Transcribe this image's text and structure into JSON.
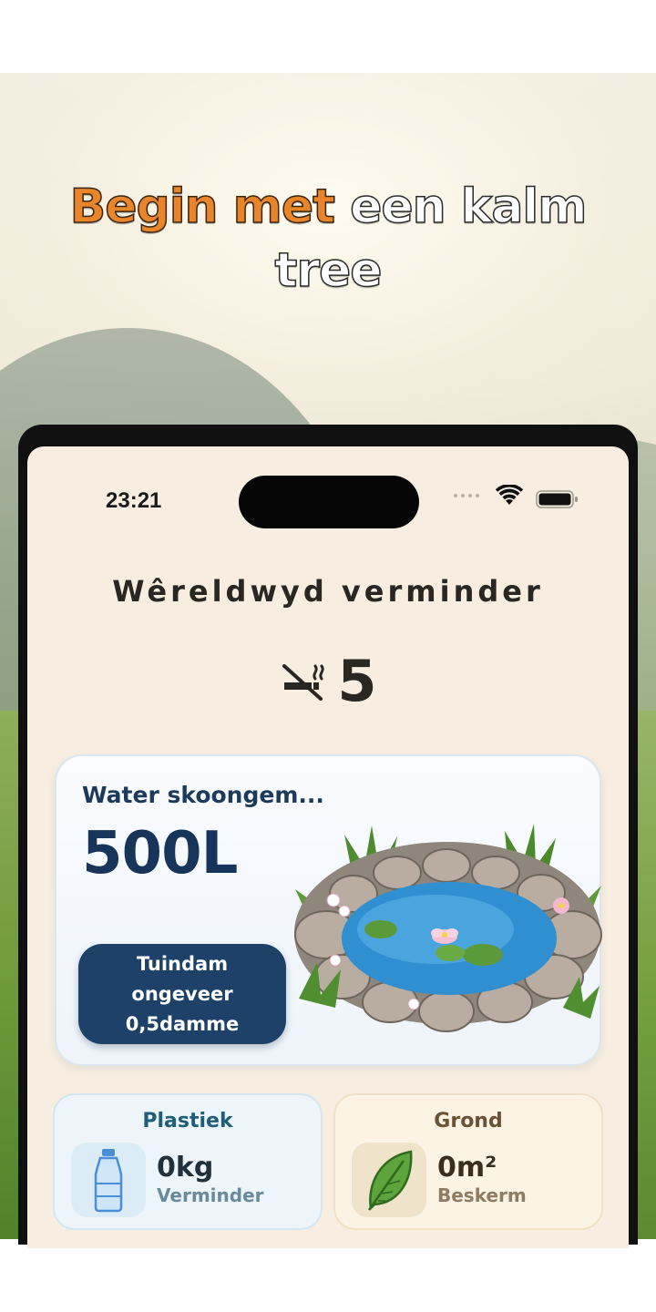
{
  "headline": {
    "accent": "Begin met",
    "rest": "een kalm",
    "line2": "tree"
  },
  "status_bar": {
    "time": "23:21",
    "icons": [
      "signal-dots-icon",
      "wifi-icon",
      "battery-icon"
    ]
  },
  "reduction": {
    "title": "Wêreldwyd verminder",
    "icon": "no-smoking-icon",
    "count": "5"
  },
  "water_card": {
    "label": "Water skoongem...",
    "amount": "500L",
    "equivalent": "Tuindam\nongeveer\n0,5damme",
    "illustration": "pond-illustration"
  },
  "plastic_card": {
    "title": "Plastiek",
    "icon": "water-bottle-icon",
    "value": "0kg",
    "subtitle": "Verminder"
  },
  "soil_card": {
    "title": "Grond",
    "icon": "leaf-icon",
    "value": "0m²",
    "subtitle": "Beskerm"
  },
  "colors": {
    "accent_orange": "#e8842a",
    "navy": "#17345a",
    "button_navy": "#1d4169",
    "screen_bg": "#f7eee1"
  }
}
